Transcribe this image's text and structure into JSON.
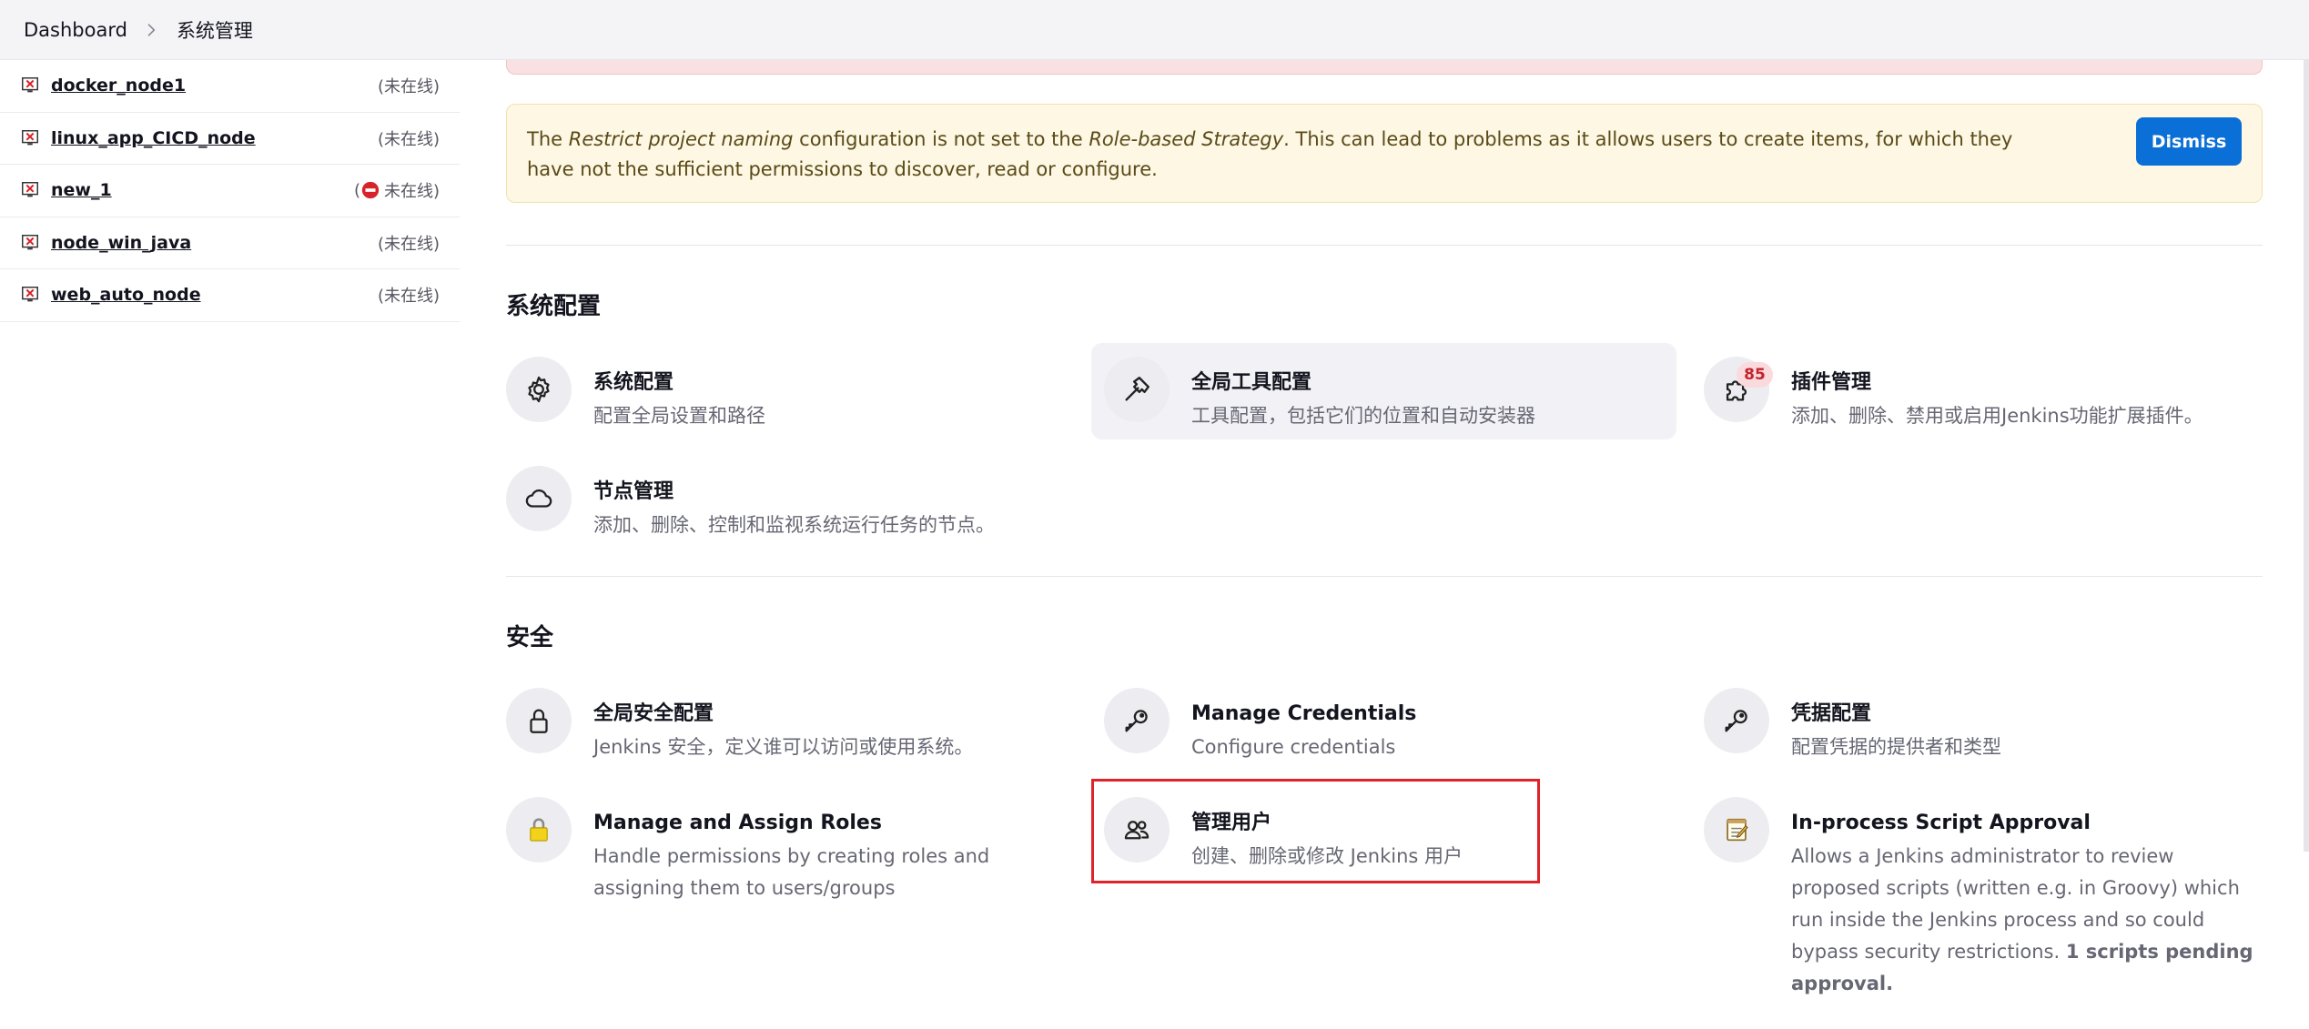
{
  "breadcrumb": {
    "items": [
      "Dashboard",
      "系统管理"
    ]
  },
  "nodes": [
    {
      "name": "docker_node1",
      "status": "(未在线)",
      "stopped": false
    },
    {
      "name": "linux_app_CICD_node",
      "status": "(未在线)",
      "stopped": false
    },
    {
      "name": "new_1",
      "status": "未在线)",
      "status_prefix": "(",
      "stopped": true
    },
    {
      "name": "node_win_java",
      "status": "(未在线)",
      "stopped": false
    },
    {
      "name": "web_auto_node",
      "status": "(未在线)",
      "stopped": false
    }
  ],
  "alert": {
    "text_1": "The ",
    "em_1": "Restrict project naming",
    "text_2": " configuration is not set to the ",
    "em_2": "Role-based Strategy",
    "text_3": ". This can lead to problems as it allows users to create items, for which they have not the sufficient permissions to discover, read or configure.",
    "dismiss_label": "Dismiss"
  },
  "sections": {
    "system": {
      "title": "系统配置",
      "cards": [
        {
          "title": "系统配置",
          "desc": "配置全局设置和路径",
          "icon": "gear-icon"
        },
        {
          "title": "全局工具配置",
          "desc": "工具配置，包括它们的位置和自动安装器",
          "icon": "hammer-icon"
        },
        {
          "title": "插件管理",
          "desc": "添加、删除、禁用或启用Jenkins功能扩展插件。",
          "icon": "puzzle-icon",
          "badge": "85"
        },
        {
          "title": "节点管理",
          "desc": "添加、删除、控制和监视系统运行任务的节点。",
          "icon": "cloud-icon"
        }
      ]
    },
    "security": {
      "title": "安全",
      "cards": [
        {
          "title": "全局安全配置",
          "desc": "Jenkins 安全，定义谁可以访问或使用系统。",
          "icon": "lock-icon"
        },
        {
          "title": "Manage Credentials",
          "desc": "Configure credentials",
          "icon": "key-icon"
        },
        {
          "title": "凭据配置",
          "desc": "配置凭据的提供者和类型",
          "icon": "key-icon"
        },
        {
          "title": "Manage and Assign Roles",
          "desc_1": "Handle permissions by creating roles and",
          "desc_2": "assigning them to users/groups",
          "icon": "padlock-icon"
        },
        {
          "title": "管理用户",
          "desc": "创建、删除或修改 Jenkins 用户",
          "icon": "users-icon"
        },
        {
          "title": "In-process Script Approval",
          "desc_1": "Allows a Jenkins administrator to review",
          "desc_2": "proposed scripts (written e.g. in Groovy) which",
          "desc_3": "run inside the Jenkins process and so could",
          "desc_4": "bypass security restrictions. ",
          "desc_bold_1": "1 scripts pending",
          "desc_bold_2": "approval.",
          "icon": "notepad-icon"
        }
      ]
    }
  },
  "colors": {
    "accent": "#0a6fd6",
    "highlight": "#e0232b",
    "warning_bg": "#fdf7e3",
    "error_bg": "#f9e0e1"
  }
}
